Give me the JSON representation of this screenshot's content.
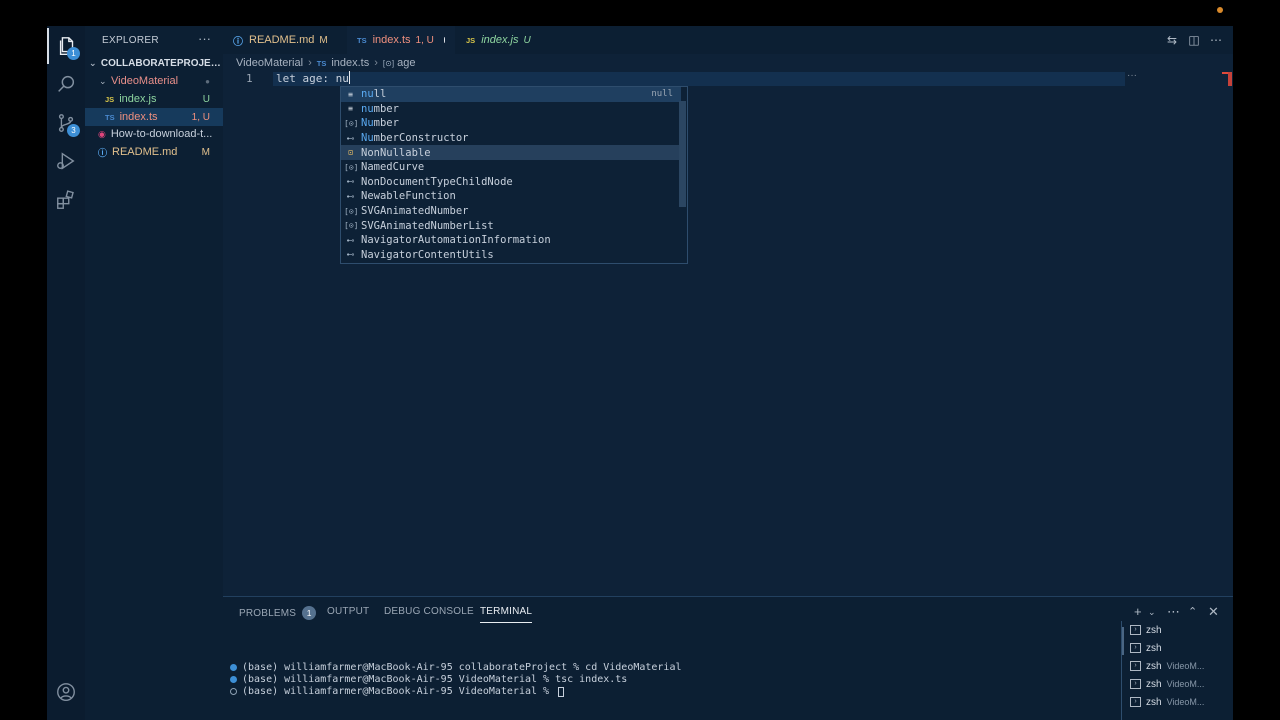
{
  "activity_bar": {
    "explorer_badge": "1",
    "source_control_badge": "3"
  },
  "sidebar": {
    "title": "EXPLORER",
    "more": "···",
    "project": "COLLABORATEPROJECT",
    "items": [
      {
        "label": "VideoMaterial",
        "status": "●",
        "kind": "folder"
      },
      {
        "label": "index.js",
        "status": "U",
        "kind": "js"
      },
      {
        "label": "index.ts",
        "status": "1, U",
        "kind": "ts"
      },
      {
        "label": "How-to-download-t...",
        "status": "",
        "kind": "video"
      },
      {
        "label": "README.md",
        "status": "M",
        "kind": "md"
      }
    ]
  },
  "tabs": [
    {
      "label": "README.md",
      "status": "M",
      "icon": "ⓘ"
    },
    {
      "label": "index.ts",
      "status": "1, U",
      "icon": "TS"
    },
    {
      "label": "index.js",
      "status": "U",
      "icon": "JS"
    }
  ],
  "breadcrumb": {
    "folder": "VideoMaterial",
    "file_icon": "TS",
    "file": "index.ts",
    "symbol_icon": "[⊙]",
    "symbol": "age"
  },
  "editor": {
    "line_number": "1",
    "code": "let age: nu"
  },
  "suggestions": {
    "items": [
      {
        "label": "null",
        "icon": "kw",
        "detail": "null"
      },
      {
        "label": "number",
        "icon": "kw",
        "detail": ""
      },
      {
        "label": "Number",
        "icon": "var",
        "detail": ""
      },
      {
        "label": "NumberConstructor",
        "icon": "iface",
        "detail": ""
      },
      {
        "label": "NonNullable",
        "icon": "type",
        "detail": ""
      },
      {
        "label": "NamedCurve",
        "icon": "var",
        "detail": ""
      },
      {
        "label": "NonDocumentTypeChildNode",
        "icon": "iface",
        "detail": ""
      },
      {
        "label": "NewableFunction",
        "icon": "iface",
        "detail": ""
      },
      {
        "label": "SVGAnimatedNumber",
        "icon": "var",
        "detail": ""
      },
      {
        "label": "SVGAnimatedNumberList",
        "icon": "var",
        "detail": ""
      },
      {
        "label": "NavigatorAutomationInformation",
        "icon": "iface",
        "detail": ""
      },
      {
        "label": "NavigatorContentUtils",
        "icon": "iface",
        "detail": ""
      }
    ]
  },
  "panel": {
    "tabs": [
      "PROBLEMS",
      "OUTPUT",
      "DEBUG CONSOLE",
      "TERMINAL"
    ],
    "problems_count": "1",
    "terminal_lines": [
      "(base) williamfarmer@MacBook-Air-95 collaborateProject % cd VideoMaterial",
      "(base) williamfarmer@MacBook-Air-95 VideoMaterial % tsc index.ts",
      "(base) williamfarmer@MacBook-Air-95 VideoMaterial % "
    ],
    "terminals": [
      {
        "name": "zsh",
        "sub": ""
      },
      {
        "name": "zsh",
        "sub": ""
      },
      {
        "name": "zsh",
        "sub": "VideoM..."
      },
      {
        "name": "zsh",
        "sub": "VideoM..."
      },
      {
        "name": "zsh",
        "sub": "VideoM..."
      }
    ]
  },
  "colors": {
    "background": "#0e2238",
    "accent": "#3d8fd6",
    "modified": "#e2c08d",
    "untracked": "#73c991",
    "error": "#f48771"
  }
}
